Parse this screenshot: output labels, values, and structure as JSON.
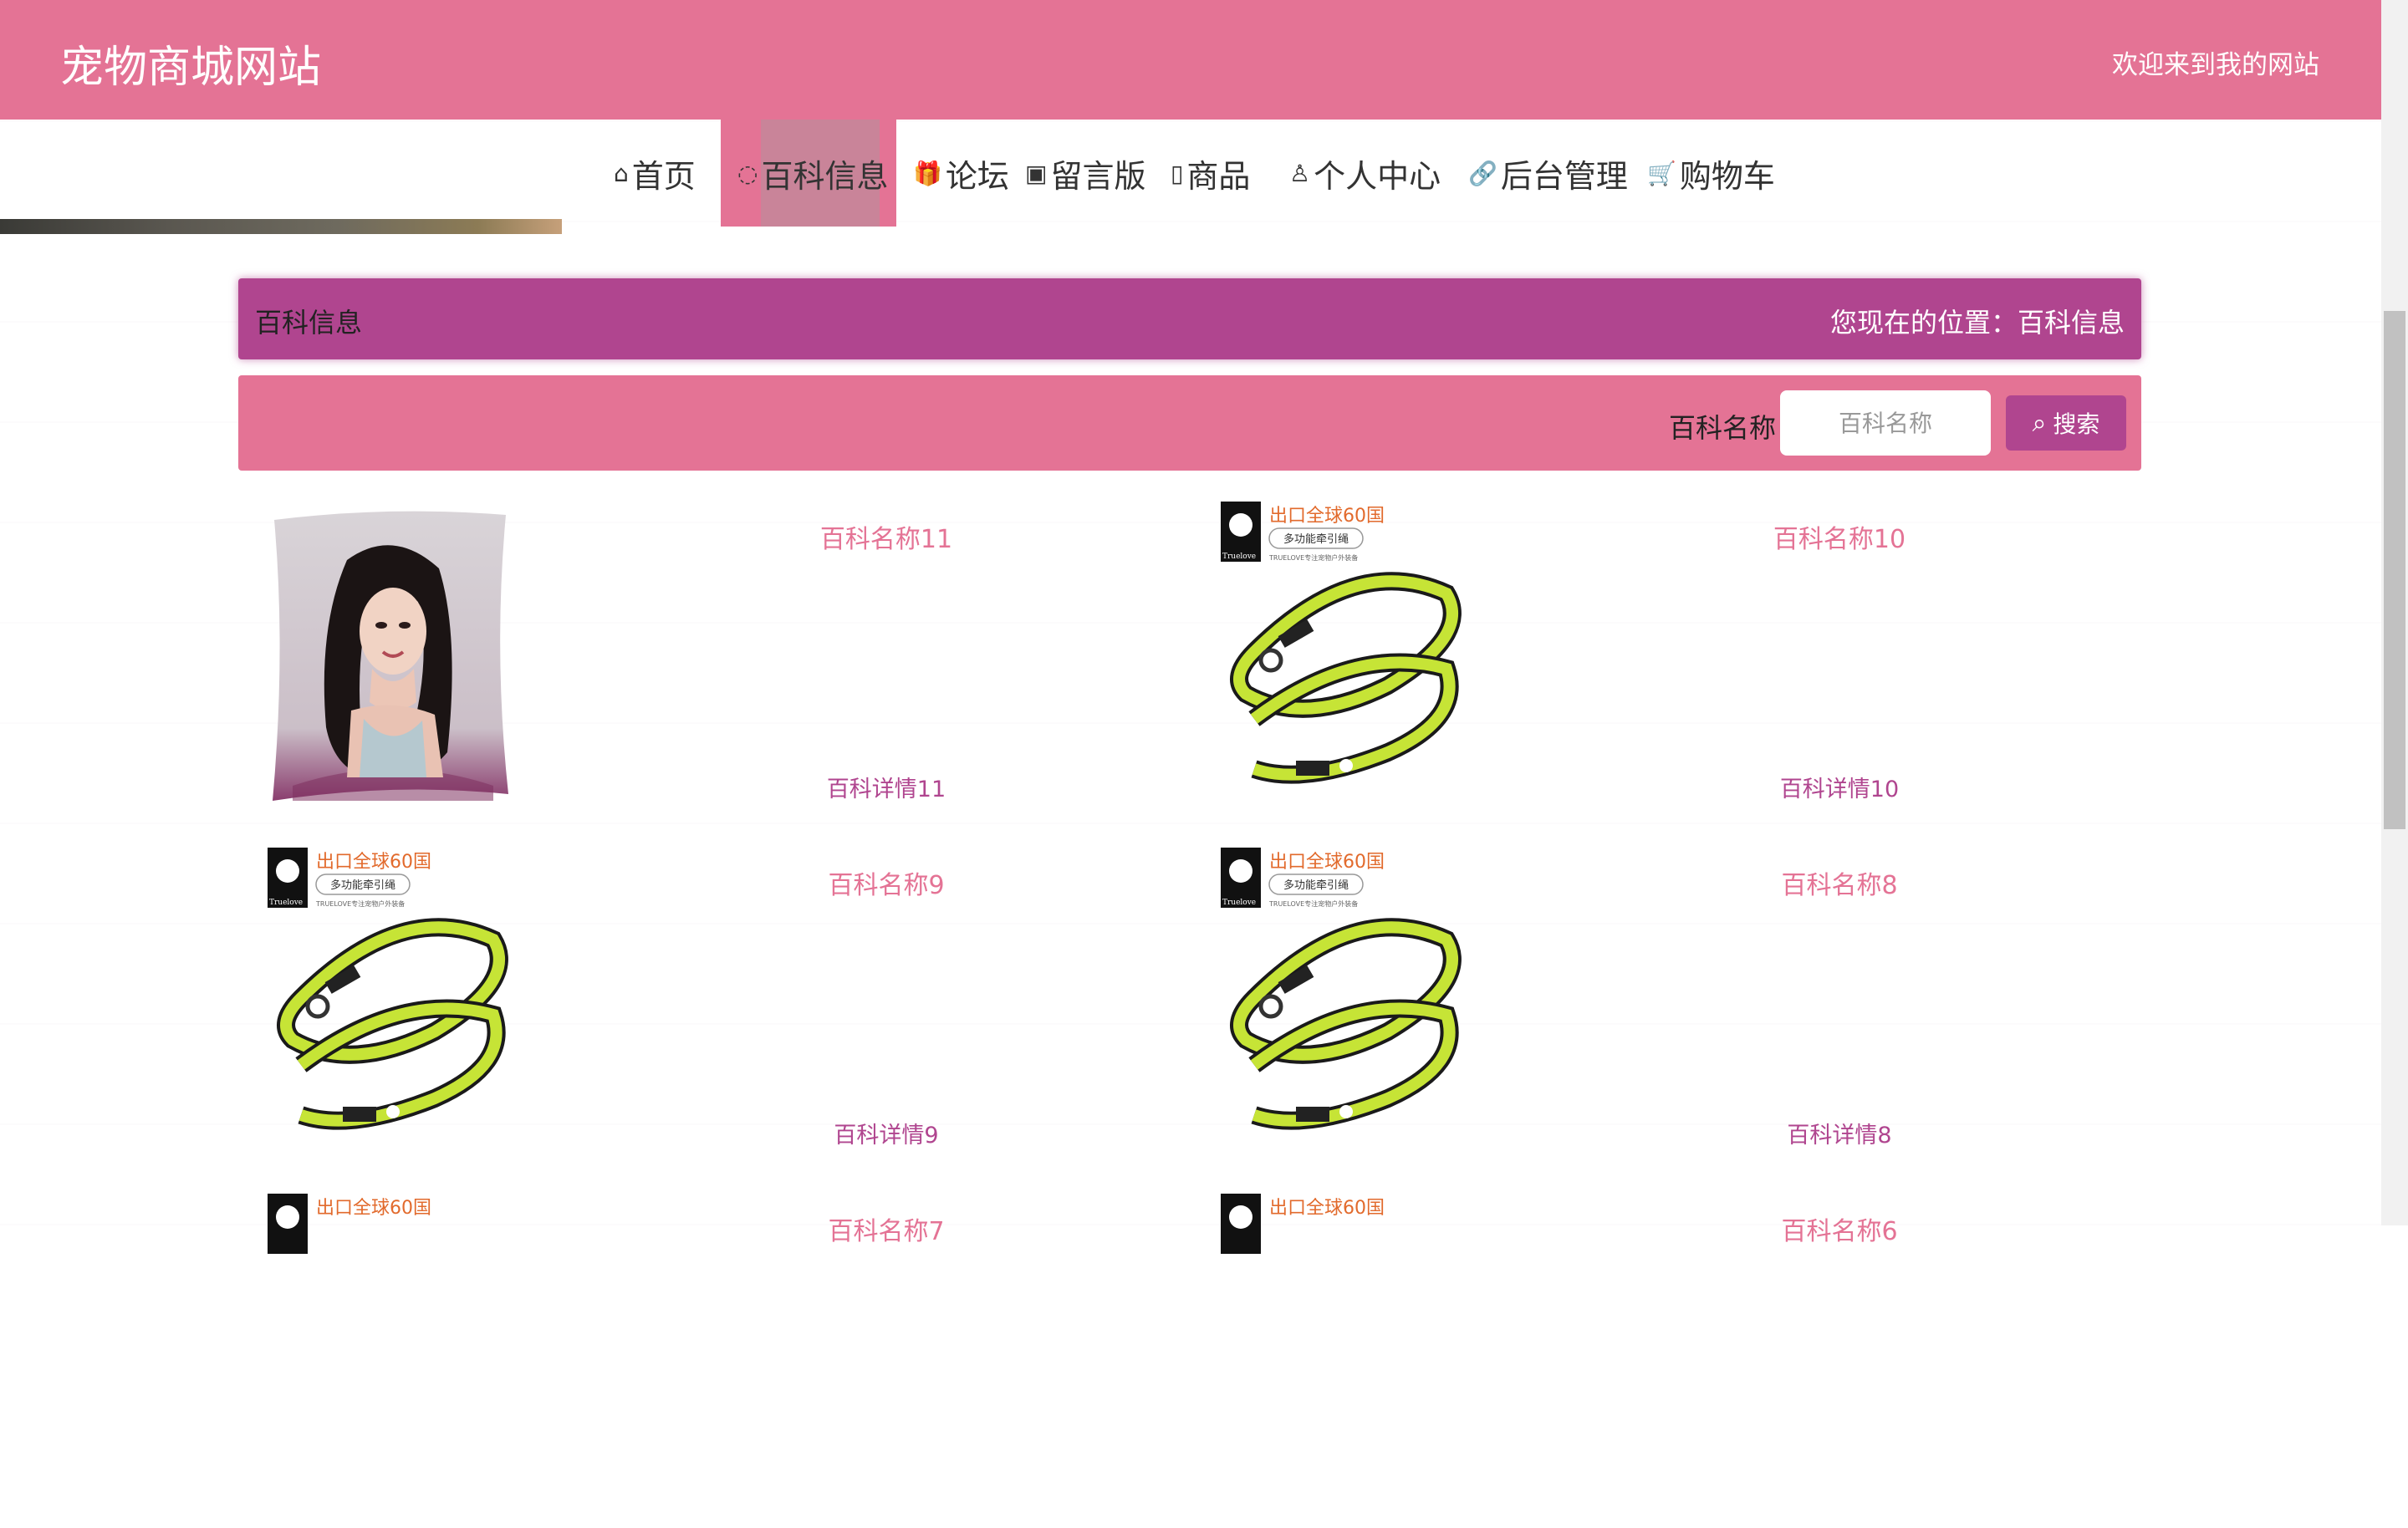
{
  "header": {
    "site_title": "宠物商城网站",
    "welcome": "欢迎来到我的网站"
  },
  "nav": {
    "items": [
      {
        "label": "首页",
        "icon": "⌂"
      },
      {
        "label": "百科信息",
        "icon": "◌"
      },
      {
        "label": "论坛",
        "icon": "🎁"
      },
      {
        "label": "留言版",
        "icon": "▣"
      },
      {
        "label": "商品",
        "icon": "▯"
      },
      {
        "label": "个人中心",
        "icon": "♙"
      },
      {
        "label": "后台管理",
        "icon": "🔗"
      },
      {
        "label": "购物车",
        "icon": "🛒"
      }
    ],
    "active_index": 1
  },
  "section": {
    "title": "百科信息",
    "breadcrumb": "您现在的位置：百科信息"
  },
  "search": {
    "label": "百科名称",
    "placeholder": "百科名称",
    "button": "搜索"
  },
  "cards": [
    {
      "name": "百科名称11",
      "detail": "百科详情11",
      "image": "pillow-portrait"
    },
    {
      "name": "百科名称10",
      "detail": "百科详情10",
      "image": "green-leash"
    },
    {
      "name": "百科名称9",
      "detail": "百科详情9",
      "image": "green-leash"
    },
    {
      "name": "百科名称8",
      "detail": "百科详情8",
      "image": "green-leash"
    },
    {
      "name": "百科名称7",
      "detail": "",
      "image": "green-leash"
    },
    {
      "name": "百科名称6",
      "detail": "",
      "image": "green-leash"
    }
  ],
  "product_label": {
    "headline": "出口全球60国",
    "sub": "多功能牵引绳",
    "fine": "TRUELOVE专注宠物户外装备",
    "brand": "Truelove"
  },
  "colors": {
    "primary_pink": "#e47395",
    "accent_purple": "#b0458f",
    "leash_green": "#c6e436"
  }
}
